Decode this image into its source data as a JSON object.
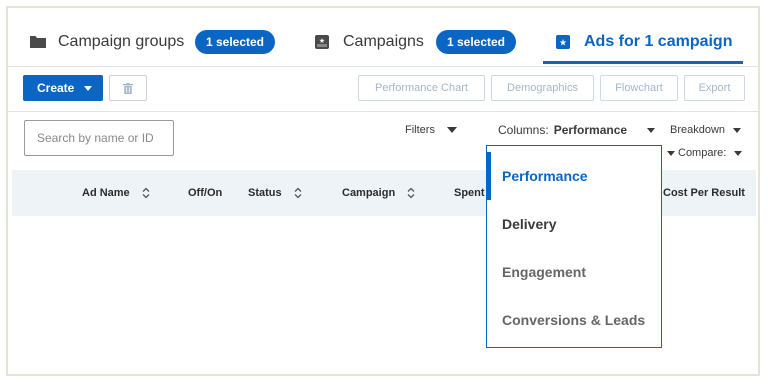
{
  "tabs": {
    "campaign_groups": {
      "label": "Campaign groups",
      "badge": "1 selected"
    },
    "campaigns": {
      "label": "Campaigns",
      "badge": "1 selected"
    },
    "ads": {
      "label": "Ads for 1 campaign"
    }
  },
  "toolbar": {
    "create_label": "Create",
    "performance_chart": "Performance Chart",
    "demographics": "Demographics",
    "flowchart": "Flowchart",
    "export": "Export"
  },
  "filters": {
    "search_placeholder": "Search by name or ID",
    "filters_label": "Filters",
    "columns_label": "Columns:",
    "columns_value": "Performance",
    "breakdown_label": "Breakdown",
    "compare_label": "Compare:"
  },
  "table": {
    "headers": [
      "Ad Name",
      "Off/On",
      "Status",
      "Campaign",
      "Spent",
      "Cost Per Result"
    ]
  },
  "columns_dropdown": {
    "items": [
      "Performance",
      "Delivery",
      "Engagement",
      "Conversions & Leads"
    ],
    "selected": "Performance"
  },
  "colors": {
    "accent": "#0a66c2",
    "header_bg": "#eef3f8"
  },
  "icons": [
    "folder-icon",
    "campaign-icon",
    "ad-icon",
    "trash-icon",
    "sort-icon",
    "chevron-down-icon"
  ]
}
